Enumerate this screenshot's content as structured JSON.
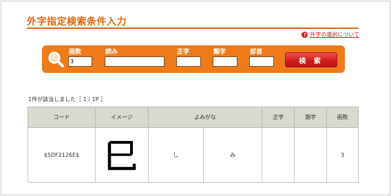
{
  "page": {
    "title": "外字指定検索条件入力"
  },
  "help": {
    "link_text": "外字の選択について",
    "icon": "question-icon"
  },
  "search": {
    "icon": "magnifier-icon",
    "fields": [
      {
        "label": "画数",
        "value": "3"
      },
      {
        "label": "読み",
        "value": ""
      },
      {
        "label": "正字",
        "value": ""
      },
      {
        "label": "類字",
        "value": ""
      },
      {
        "label": "部首",
        "value": ""
      }
    ],
    "button_label": "検 索"
  },
  "result": {
    "summary": "1件が該当しました［ 1 / 1P ］"
  },
  "table": {
    "headers": [
      "コード",
      "イメージ",
      "よみがな",
      "正字",
      "類字",
      "画数"
    ],
    "rows": [
      {
        "code": "$5DF2126E$",
        "image_glyph": "己",
        "reading_1": "し",
        "reading_2": "み",
        "seiji": "",
        "ruiji": "",
        "stroke_count": "3"
      }
    ]
  },
  "colors": {
    "accent": "#e8620e",
    "bar": "#ef7a1a",
    "button": "#d21e1e",
    "header_bg": "#d9d9cf"
  }
}
